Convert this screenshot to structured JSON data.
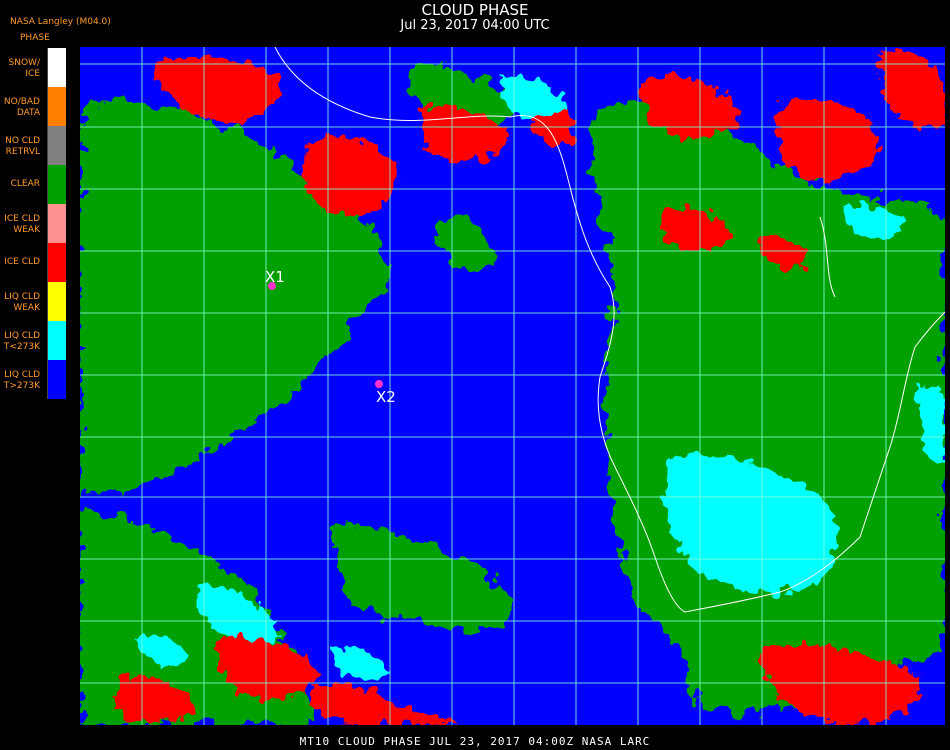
{
  "header": {
    "org_label": "NASA Langley (M04.0)",
    "title": "CLOUD PHASE",
    "timestamp": "Jul 23, 2017 04:00 UTC"
  },
  "legend": {
    "title": "PHASE",
    "items": [
      {
        "label": "SNOW/\nICE",
        "color": "#ffffff"
      },
      {
        "label": "NO/BAD\nDATA",
        "color": "#ff8000"
      },
      {
        "label": "NO CLD\nRETRVL",
        "color": "#808080"
      },
      {
        "label": "CLEAR",
        "color": "#00a000"
      },
      {
        "label": "ICE CLD\nWEAK",
        "color": "#ff9090"
      },
      {
        "label": "ICE CLD",
        "color": "#ff0000"
      },
      {
        "label": "LIQ CLD\nWEAK",
        "color": "#ffff00"
      },
      {
        "label": "LIQ CLD\nT<273K",
        "color": "#00ffff"
      },
      {
        "label": "LIQ CLD\nT>273K",
        "color": "#0000ff"
      }
    ]
  },
  "markers": [
    {
      "label": "X1"
    },
    {
      "label": "X2"
    }
  ],
  "footer": {
    "text": "MT10  CLOUD PHASE   JUL 23, 2017 04:00Z   NASA LARC"
  },
  "colors": {
    "ocean_liquid": "#0000ff",
    "clear": "#00a000",
    "ice": "#ff0000",
    "liquid_cold": "#00ffff",
    "grid": "#7fffd4",
    "coast": "#ffffff",
    "legend_text": "#ff9a2e",
    "marker": "#ff33cc"
  }
}
